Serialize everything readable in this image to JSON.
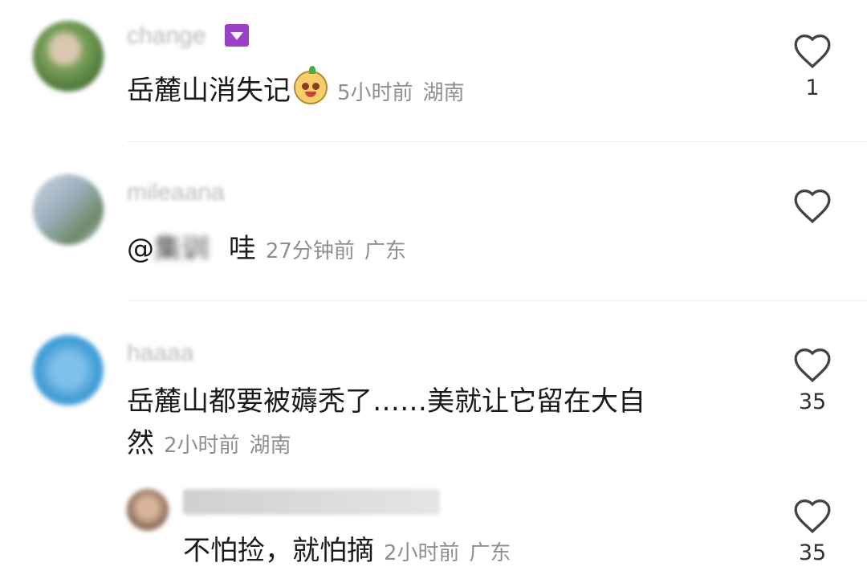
{
  "comments": [
    {
      "username": "change",
      "text": "岳麓山消失记",
      "emoji": "smiling-mascot-emoji",
      "time": "5小时前",
      "region": "湖南",
      "likes": "1"
    },
    {
      "username": "mileaana",
      "mention_prefix": "@",
      "mention_name": "集训",
      "text": "哇",
      "time": "27分钟前",
      "region": "广东",
      "likes": ""
    },
    {
      "username": "haaaa",
      "text_line1": "岳麓山都要被薅秃了……美就让它留在大自",
      "text_line2": "然",
      "time": "2小时前",
      "region": "湖南",
      "likes": "35"
    }
  ],
  "reply": {
    "username": "...",
    "text": "不怕捡，就怕摘",
    "time": "2小时前",
    "region": "广东",
    "likes": "35"
  },
  "colors": {
    "meta": "#8f8f8f",
    "badge": "#9a3fc8",
    "heart": "#444444"
  },
  "icons": {
    "like": "heart-outline-icon"
  }
}
